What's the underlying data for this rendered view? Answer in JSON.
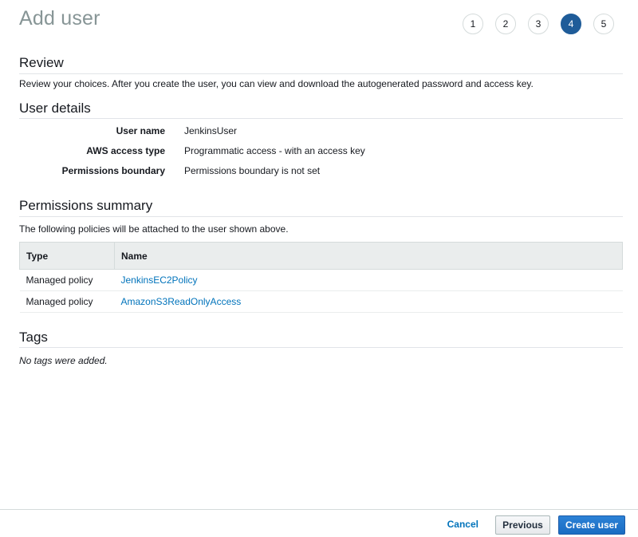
{
  "header": {
    "title": "Add user",
    "steps": [
      "1",
      "2",
      "3",
      "4",
      "5"
    ],
    "active_step": "4"
  },
  "review": {
    "title": "Review",
    "intro": "Review your choices. After you create the user, you can view and download the autogenerated password and access key."
  },
  "user_details": {
    "title": "User details",
    "rows": [
      {
        "label": "User name",
        "value": "JenkinsUser"
      },
      {
        "label": "AWS access type",
        "value": "Programmatic access - with an access key"
      },
      {
        "label": "Permissions boundary",
        "value": "Permissions boundary is not set"
      }
    ]
  },
  "permissions_summary": {
    "title": "Permissions summary",
    "note": "The following policies will be attached to the user shown above.",
    "columns": [
      "Type",
      "Name"
    ],
    "rows": [
      {
        "type": "Managed policy",
        "name": "JenkinsEC2Policy"
      },
      {
        "type": "Managed policy",
        "name": "AmazonS3ReadOnlyAccess"
      }
    ]
  },
  "tags": {
    "title": "Tags",
    "empty_text": "No tags were added."
  },
  "footer": {
    "cancel_label": "Cancel",
    "previous_label": "Previous",
    "create_label": "Create user"
  },
  "colors": {
    "accent": "#1f5c99",
    "link": "#0073bb",
    "primary_button": "#1a6cc2"
  }
}
